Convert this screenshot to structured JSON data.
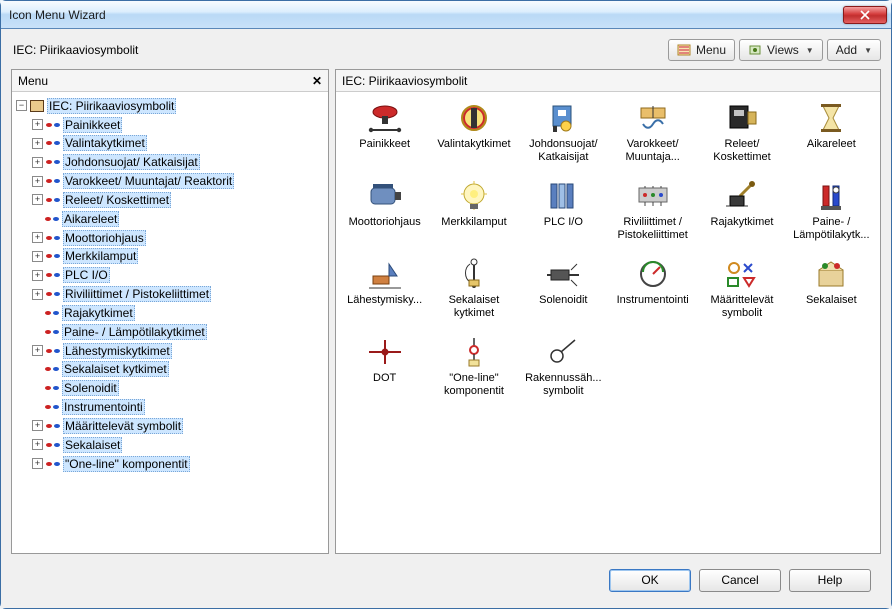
{
  "window": {
    "title": "Icon Menu Wizard"
  },
  "toolbar": {
    "main_label": "IEC: Piirikaaviosymbolit",
    "menu": "Menu",
    "views": "Views",
    "add": "Add"
  },
  "treePanel": {
    "header": "Menu",
    "root": {
      "label": "IEC: Piirikaaviosymbolit",
      "children": [
        {
          "label": "Painikkeet",
          "expandable": true
        },
        {
          "label": "Valintakytkimet",
          "expandable": true
        },
        {
          "label": "Johdonsuojat/ Katkaisijat",
          "expandable": true
        },
        {
          "label": "Varokkeet/ Muuntajat/ Reaktorit",
          "expandable": true
        },
        {
          "label": "Releet/ Koskettimet",
          "expandable": true
        },
        {
          "label": "Aikareleet",
          "expandable": false
        },
        {
          "label": "Moottoriohjaus",
          "expandable": true
        },
        {
          "label": "Merkkilamput",
          "expandable": true
        },
        {
          "label": "PLC I/O",
          "expandable": true
        },
        {
          "label": "Riviliittimet / Pistokeliittimet",
          "expandable": true
        },
        {
          "label": "Rajakytkimet",
          "expandable": false
        },
        {
          "label": "Paine- / Lämpötilakytkimet",
          "expandable": false
        },
        {
          "label": "Lähestymiskytkimet",
          "expandable": true
        },
        {
          "label": "Sekalaiset kytkimet",
          "expandable": false
        },
        {
          "label": "Solenoidit",
          "expandable": false
        },
        {
          "label": "Instrumentointi",
          "expandable": false
        },
        {
          "label": "Määrittelevät symbolit",
          "expandable": true
        },
        {
          "label": "Sekalaiset",
          "expandable": true
        },
        {
          "label": "\"One-line\" komponentit",
          "expandable": true
        }
      ]
    }
  },
  "gridPanel": {
    "header": "IEC: Piirikaaviosymbolit",
    "items": [
      {
        "label": "Painikkeet",
        "icon": "pushbutton"
      },
      {
        "label": "Valintakytkimet",
        "icon": "selector"
      },
      {
        "label": "Johdonsuojat/ Katkaisijat",
        "icon": "breaker"
      },
      {
        "label": "Varokkeet/ Muuntaja...",
        "icon": "fuse-xfmr"
      },
      {
        "label": "Releet/ Koskettimet",
        "icon": "relay"
      },
      {
        "label": "Aikareleet",
        "icon": "hourglass"
      },
      {
        "label": "Moottoriohjaus",
        "icon": "motor"
      },
      {
        "label": "Merkkilamput",
        "icon": "pilot-lamp"
      },
      {
        "label": "PLC I/O",
        "icon": "plc"
      },
      {
        "label": "Riviliittimet / Pistokeliittimet",
        "icon": "terminals"
      },
      {
        "label": "Rajakytkimet",
        "icon": "limit-switch"
      },
      {
        "label": "Paine- / Lämpötilakytk...",
        "icon": "pressure"
      },
      {
        "label": "Lähestymisky...",
        "icon": "proximity"
      },
      {
        "label": "Sekalaiset kytkimet",
        "icon": "misc-switch"
      },
      {
        "label": "Solenoidit",
        "icon": "solenoid"
      },
      {
        "label": "Instrumentointi",
        "icon": "gauge"
      },
      {
        "label": "Määrittelevät symbolit",
        "icon": "qualifying"
      },
      {
        "label": "Sekalaiset",
        "icon": "misc"
      },
      {
        "label": "DOT",
        "icon": "dot"
      },
      {
        "label": "\"One-line\" komponentit",
        "icon": "one-line"
      },
      {
        "label": "Rakennussäh... symbolit",
        "icon": "building-elec"
      }
    ]
  },
  "footer": {
    "ok": "OK",
    "cancel": "Cancel",
    "help": "Help"
  }
}
